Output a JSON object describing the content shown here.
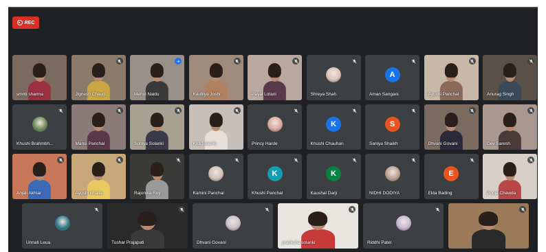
{
  "recording": {
    "label": "REC",
    "color": "#d93025"
  },
  "participants": [
    {
      "name": "smriti sharma",
      "type": "video",
      "bg": "#7a6a60",
      "shirt": "#9a3040",
      "mic": "none"
    },
    {
      "name": "Jignesh Chaud...",
      "type": "video",
      "bg": "#8a7b6a",
      "shirt": "#c9a544",
      "mic": "muted"
    },
    {
      "name": "Mehul Naidu",
      "type": "video",
      "bg": "#9a9088",
      "shirt": "#3a3a3a",
      "mic": "active"
    },
    {
      "name": "Kautilya Joshi",
      "type": "video",
      "bg": "#a08a7a",
      "shirt": "#b08060",
      "mic": "muted"
    },
    {
      "name": "Payal Lotani",
      "type": "video",
      "bg": "#b8a8a0",
      "shirt": "#5a3a4a",
      "mic": "muted"
    },
    {
      "name": "Shreya Shah",
      "type": "avatar",
      "initial": "",
      "avatarColor": "#d9c4b8",
      "mic": "muted"
    },
    {
      "name": "Aman Sangani",
      "type": "avatar",
      "initial": "A",
      "avatarColor": "#1a73e8",
      "mic": "muted"
    },
    {
      "name": "Ayushi Panchal",
      "type": "video",
      "bg": "#c8b8a8",
      "shirt": "#8a6a5a",
      "mic": "muted"
    },
    {
      "name": "Anurag Singh",
      "type": "video",
      "bg": "#5a5048",
      "shirt": "#3a4a5a",
      "mic": "muted"
    },
    {
      "name": "Khushi Brahmbh...",
      "type": "avatar",
      "initial": "",
      "avatarColor": "#6a8a5a",
      "mic": "muted"
    },
    {
      "name": "Mansi Panchal",
      "type": "video",
      "bg": "#8a7a78",
      "shirt": "#5a3848",
      "mic": "muted"
    },
    {
      "name": "Soniya Solanki",
      "type": "video",
      "bg": "#a8a090",
      "shirt": "#3a3a4a",
      "mic": "muted"
    },
    {
      "name": "Kriti Solanki",
      "type": "video",
      "bg": "#c8c0b8",
      "shirt": "#e8e0d8",
      "mic": "muted"
    },
    {
      "name": "Princy Harde",
      "type": "avatar",
      "initial": "",
      "avatarColor": "#d8a8a0",
      "mic": "muted"
    },
    {
      "name": "Khushi Chauhan",
      "type": "avatar",
      "initial": "K",
      "avatarColor": "#1a73e8",
      "mic": "muted"
    },
    {
      "name": "Saniya Shaikh",
      "type": "avatar",
      "initial": "S",
      "avatarColor": "#e8541f",
      "mic": "muted"
    },
    {
      "name": "Dhvani Govani",
      "type": "video",
      "bg": "#7a6a60",
      "shirt": "#2a2a3a",
      "mic": "muted"
    },
    {
      "name": "Dev Saresh",
      "type": "video",
      "bg": "#a89890",
      "shirt": "#4a3a3a",
      "mic": "muted"
    },
    {
      "name": "Anjali Akhtar",
      "type": "video",
      "bg": "#c87858",
      "shirt": "#3a6ab8",
      "mic": "muted"
    },
    {
      "name": "Ayushi Bhalla",
      "type": "video",
      "bg": "#c8a878",
      "shirt": "#e8c860",
      "mic": "muted"
    },
    {
      "name": "Rajonika Roy",
      "type": "video",
      "bg": "#3a3a38",
      "shirt": "#9a9a9a",
      "mic": "muted"
    },
    {
      "name": "Kamini Panchal",
      "type": "avatar",
      "initial": "",
      "avatarColor": "#d0c0b8",
      "mic": "muted"
    },
    {
      "name": "Khushi Panchal",
      "type": "avatar",
      "initial": "K",
      "avatarColor": "#129eaf",
      "mic": "muted"
    },
    {
      "name": "Kaushal Darji",
      "type": "avatar",
      "initial": "K",
      "avatarColor": "#0b8043",
      "mic": "muted"
    },
    {
      "name": "NIDHI DODIYA",
      "type": "avatar",
      "initial": "",
      "avatarColor": "#b8a090",
      "mic": "muted"
    },
    {
      "name": "Ekta Bading",
      "type": "avatar",
      "initial": "E",
      "avatarColor": "#e8541f",
      "mic": "muted"
    },
    {
      "name": "Pooja Chawda",
      "type": "video",
      "bg": "#d8d0c8",
      "shirt": "#b84848",
      "mic": "muted"
    },
    {
      "name": "Unnati Leua",
      "type": "avatar",
      "initial": "",
      "avatarColor": "#2a7a8a",
      "mic": "muted"
    },
    {
      "name": "Tushar Prajapati",
      "type": "video",
      "bg": "#2a2a2a",
      "shirt": "#3a3a3a",
      "mic": "muted"
    },
    {
      "name": "Dhvani Govani",
      "type": "avatar",
      "initial": "",
      "avatarColor": "#c8c0c8",
      "mic": "muted"
    },
    {
      "name": "pratiksha solanki",
      "type": "video",
      "bg": "#e8e4e0",
      "shirt": "#c83a3a",
      "mic": "muted"
    },
    {
      "name": "Riddhi Patel",
      "type": "avatar",
      "initial": "",
      "avatarColor": "#c8b8d8",
      "mic": "muted"
    },
    {
      "name": "",
      "type": "video",
      "bg": "#9a7a58",
      "shirt": "#2a2a2a",
      "mic": "muted"
    }
  ]
}
